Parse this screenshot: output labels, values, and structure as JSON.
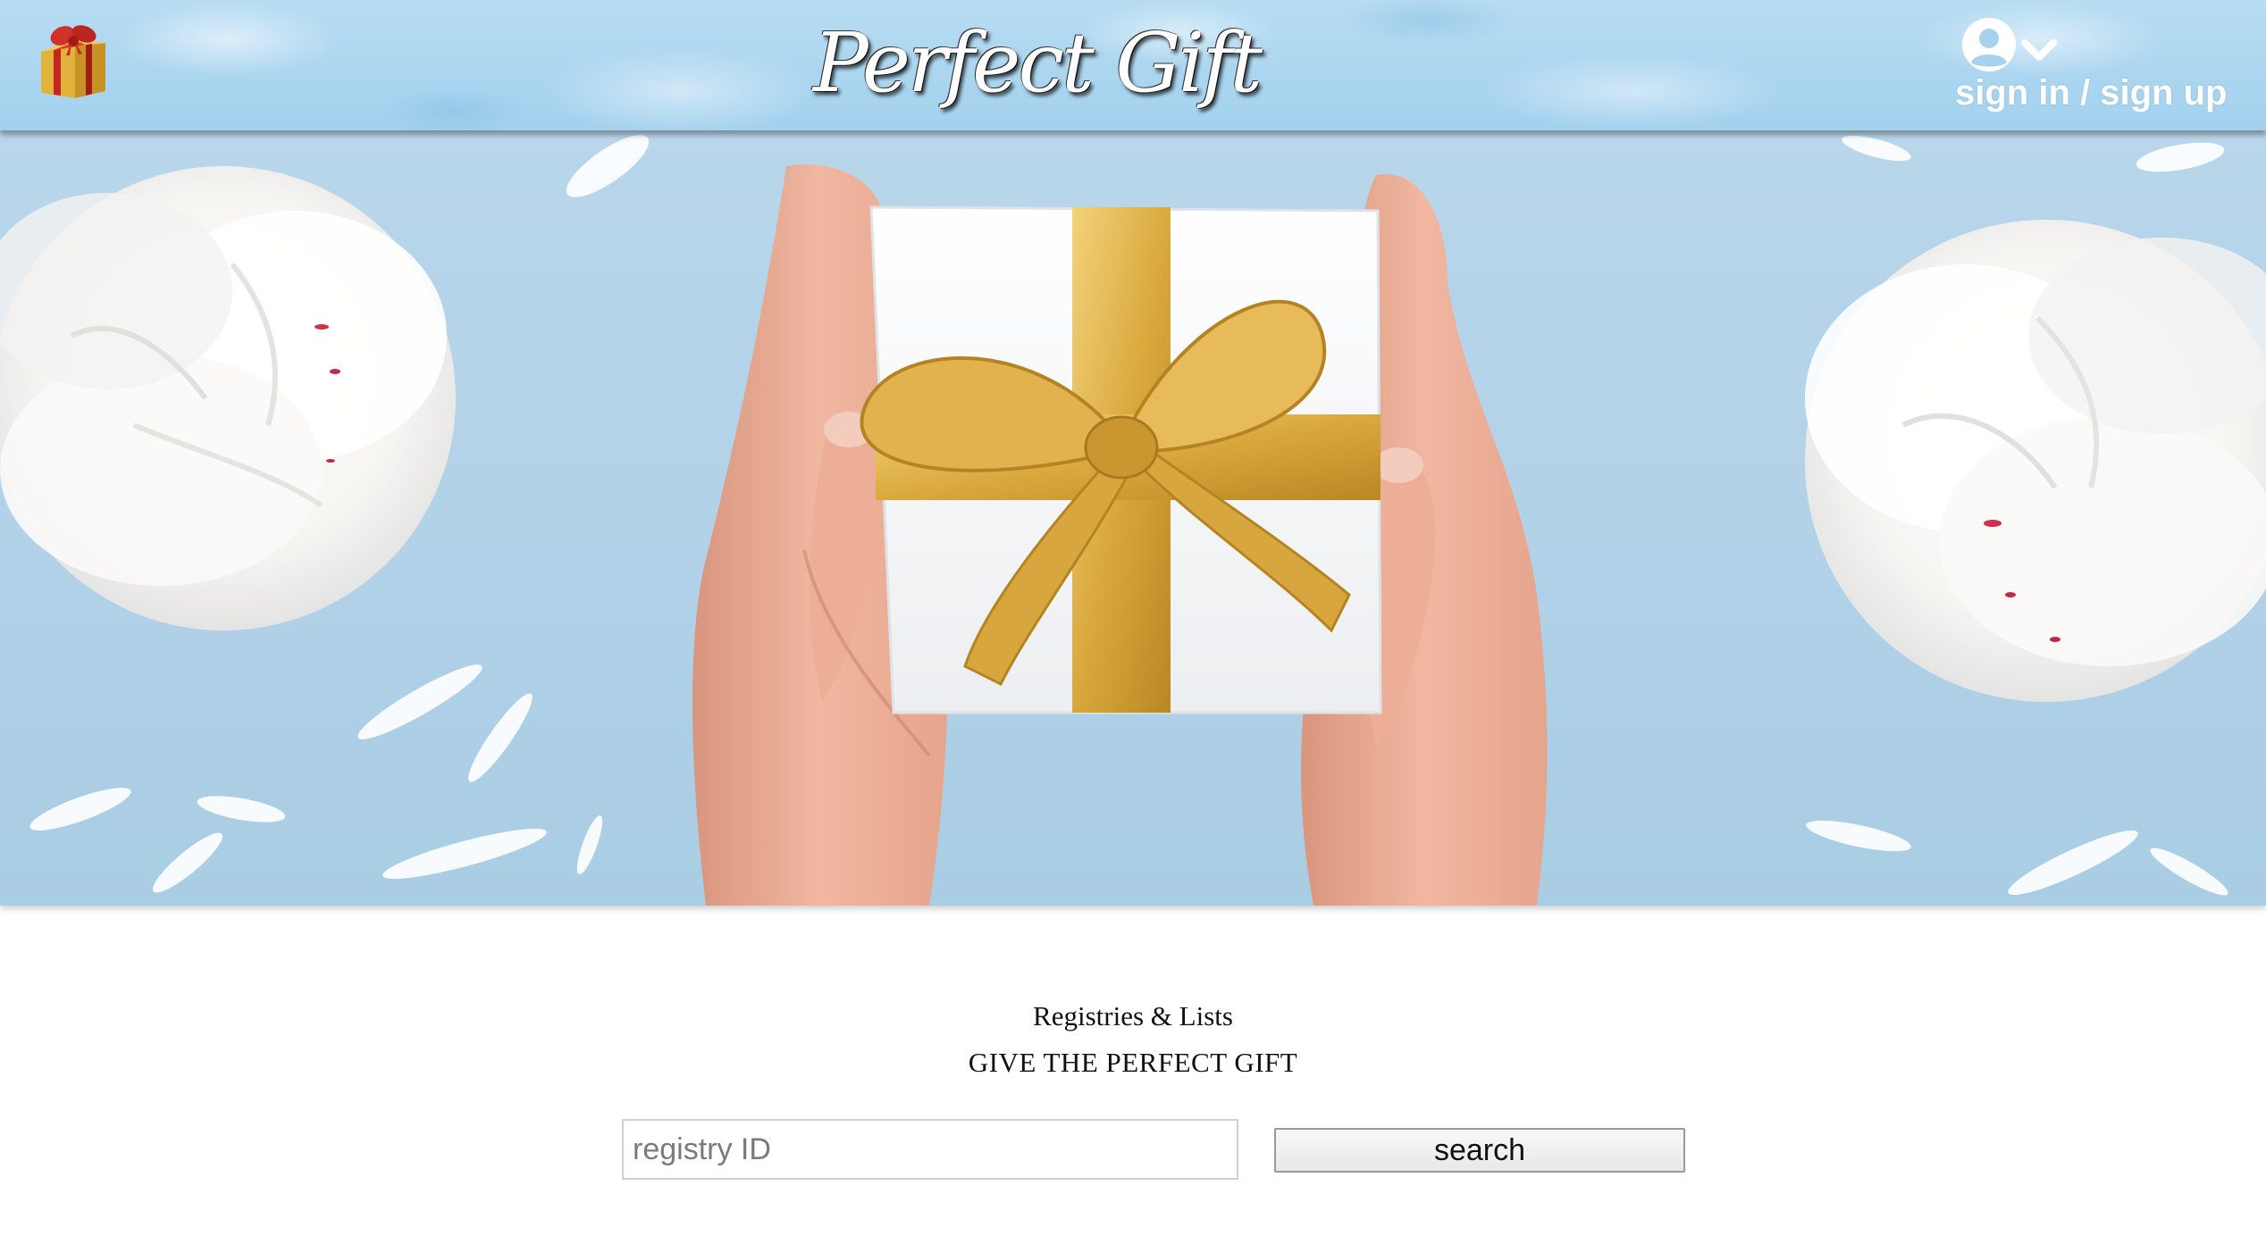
{
  "header": {
    "brand_title": "Perfect Gift",
    "account_label": "sign in / sign up",
    "logo_icon": "gift-box-icon",
    "account_icon": "user-circle-icon",
    "dropdown_icon": "chevron-down-icon"
  },
  "hero": {
    "image": "hands-holding-gift-box-with-gold-ribbon-and-white-peonies"
  },
  "registry": {
    "kicker": "Registries & Lists",
    "headline": "GIVE THE PERFECT GIFT",
    "input_placeholder": "registry ID",
    "search_label": "search"
  },
  "colors": {
    "header_sky": "#a3d1ee",
    "hero_background": "#b2d2e8",
    "ribbon_gold": "#d9a93e",
    "text": "#111111"
  }
}
